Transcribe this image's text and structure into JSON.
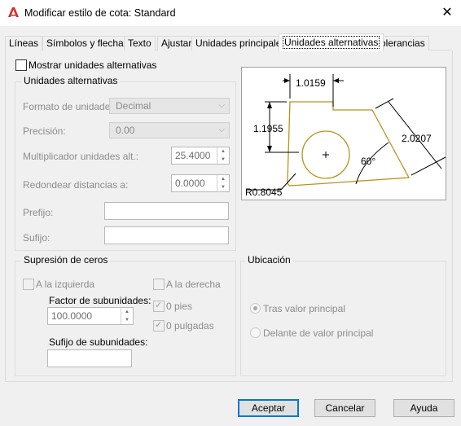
{
  "window": {
    "title": "Modificar estilo de cota: Standard",
    "close": "✕"
  },
  "tabs": [
    {
      "label": "Líneas"
    },
    {
      "label": "Símbolos y flechas"
    },
    {
      "label": "Texto"
    },
    {
      "label": "Ajustar"
    },
    {
      "label": "Unidades principales"
    },
    {
      "label": "Unidades alternativas"
    },
    {
      "label": "Tolerancias"
    }
  ],
  "show_alt": {
    "label": "Mostrar unidades alternativas",
    "checked": false
  },
  "alt_units": {
    "group_label": "Unidades alternativas",
    "format_label": "Formato de unidades:",
    "format_value": "Decimal",
    "precision_label": "Precisión:",
    "precision_value": "0.00",
    "multiplier_label": "Multiplicador unidades alt.:",
    "multiplier_value": "25.4000",
    "round_label": "Redondear distancias a:",
    "round_value": "0.0000",
    "prefix_label": "Prefijo:",
    "prefix_value": "",
    "suffix_label": "Sufijo:",
    "suffix_value": ""
  },
  "zero_suppression": {
    "group_label": "Supresión de ceros",
    "leading_label": "A la izquierda",
    "trailing_label": "A la derecha",
    "sub_factor_label": "Factor de subunidades:",
    "sub_factor_value": "100.0000",
    "sub_suffix_label": "Sufijo de subunidades:",
    "sub_suffix_value": "",
    "feet_label": "0 pies",
    "inches_label": "0 pulgadas"
  },
  "placement": {
    "group_label": "Ubicación",
    "after_label": "Tras valor principal",
    "before_label": "Delante de valor principal"
  },
  "preview": {
    "dim_top": "1.0159",
    "dim_left": "1.1955",
    "dim_right": "2.0207",
    "angle": "60°",
    "radius": "R0.8045"
  },
  "buttons": {
    "ok": "Aceptar",
    "cancel": "Cancelar",
    "help": "Ayuda"
  },
  "colors": {
    "accent": "#0078d7",
    "shape": "#b8931e"
  }
}
